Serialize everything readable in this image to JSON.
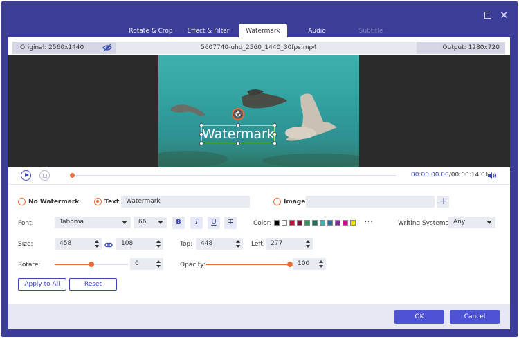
{
  "window": {
    "maximize_icon": "maximize-icon",
    "close_icon": "close-icon"
  },
  "tabs": [
    {
      "label": "Rotate & Crop",
      "state": "normal"
    },
    {
      "label": "Effect & Filter",
      "state": "normal"
    },
    {
      "label": "Watermark",
      "state": "active"
    },
    {
      "label": "Audio",
      "state": "normal"
    },
    {
      "label": "Subtitle",
      "state": "disabled"
    }
  ],
  "infobar": {
    "original": "Original: 2560x1440",
    "filename": "5607740-uhd_2560_1440_30fps.mp4",
    "output": "Output: 1280x720"
  },
  "preview": {
    "watermark_text": "Watermark"
  },
  "playback": {
    "current_time": "00:00:00.00",
    "total_time": "/00:00:14.01",
    "progress": 0.0
  },
  "watermark_type": {
    "none_label": "No Watermark",
    "text_label": "Text",
    "text_value": "Watermark",
    "image_label": "Image",
    "image_value": "",
    "selected": "text"
  },
  "font": {
    "label": "Font:",
    "family": "Tahoma",
    "size": "66",
    "bold": "B",
    "italic": "I",
    "underline": "U",
    "strike": "T"
  },
  "color": {
    "label": "Color:",
    "swatches": [
      "#000000",
      "#ffffff",
      "#c0143c",
      "#7a1a3a",
      "#2e9a5a",
      "#1e6e5a",
      "#40b0b0",
      "#2e6ea0",
      "#8a2aa0",
      "#c01490",
      "#e8e000"
    ],
    "more": "···"
  },
  "writing_systems": {
    "label": "Writing Systems:",
    "value": "Any"
  },
  "size": {
    "label": "Size:",
    "width": "458",
    "height": "108"
  },
  "position": {
    "top_label": "Top:",
    "top": "448",
    "left_label": "Left:",
    "left": "277"
  },
  "rotate": {
    "label": "Rotate:",
    "value": "0",
    "slider_fraction": 0.5
  },
  "opacity": {
    "label": "Opacity:",
    "value": "100",
    "slider_fraction": 1.0
  },
  "actions": {
    "apply_all": "Apply to All",
    "reset": "Reset"
  },
  "footer": {
    "ok": "OK",
    "cancel": "Cancel"
  },
  "colors": {
    "frame": "#3b3d99",
    "accent": "#e86b3a",
    "primary": "#4e53d6",
    "link": "#3b47b8"
  }
}
